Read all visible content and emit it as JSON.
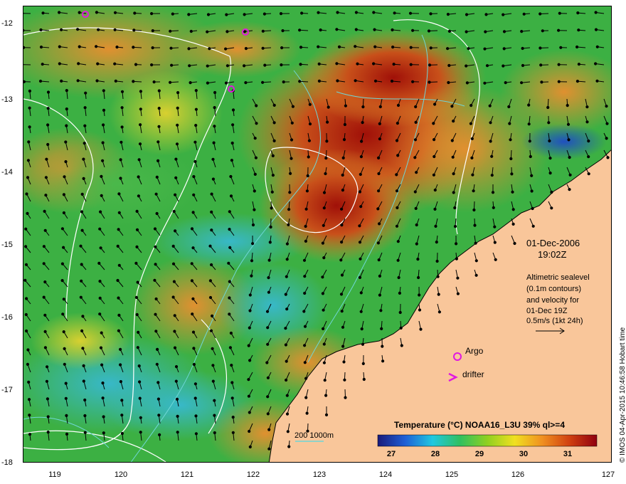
{
  "map": {
    "y_axis_labels": [
      "-12",
      "-13",
      "-14",
      "-15",
      "-16",
      "-17",
      "-18"
    ],
    "x_axis_labels": [
      "119",
      "120",
      "121",
      "122",
      "123",
      "124",
      "125",
      "126",
      "127"
    ],
    "date_line1": "01-Dec-2006",
    "date_line2": "19:02Z",
    "altimetry_text": [
      "Altimetric sealevel",
      "(0.1m contours)",
      "and velocity for",
      "01-Dec 19Z",
      "0.5m/s (1kt 24h)"
    ],
    "argo_label": "Argo",
    "drifter_label": "drifter",
    "depth_contour_label": "200  1000m",
    "colorbar_title": "Temperature (°C) NOAA16_L3U 39% ql>=4",
    "colorbar_ticks": [
      "27",
      "28",
      "29",
      "30",
      "31"
    ],
    "credit": "© IMOS 04-Apr-2015 10:46:58 Hobart time",
    "colors": {
      "land": "#f9c69a",
      "argo_marker": "#e018e0",
      "depth_contour": "#6fd6d6",
      "sealevel_contour": "#ffffff"
    },
    "colorbar_stops": [
      "#1a1a7a",
      "#1e5fd6",
      "#20c8e0",
      "#30c060",
      "#90d020",
      "#f0e020",
      "#f09020",
      "#d04010",
      "#900010"
    ]
  }
}
